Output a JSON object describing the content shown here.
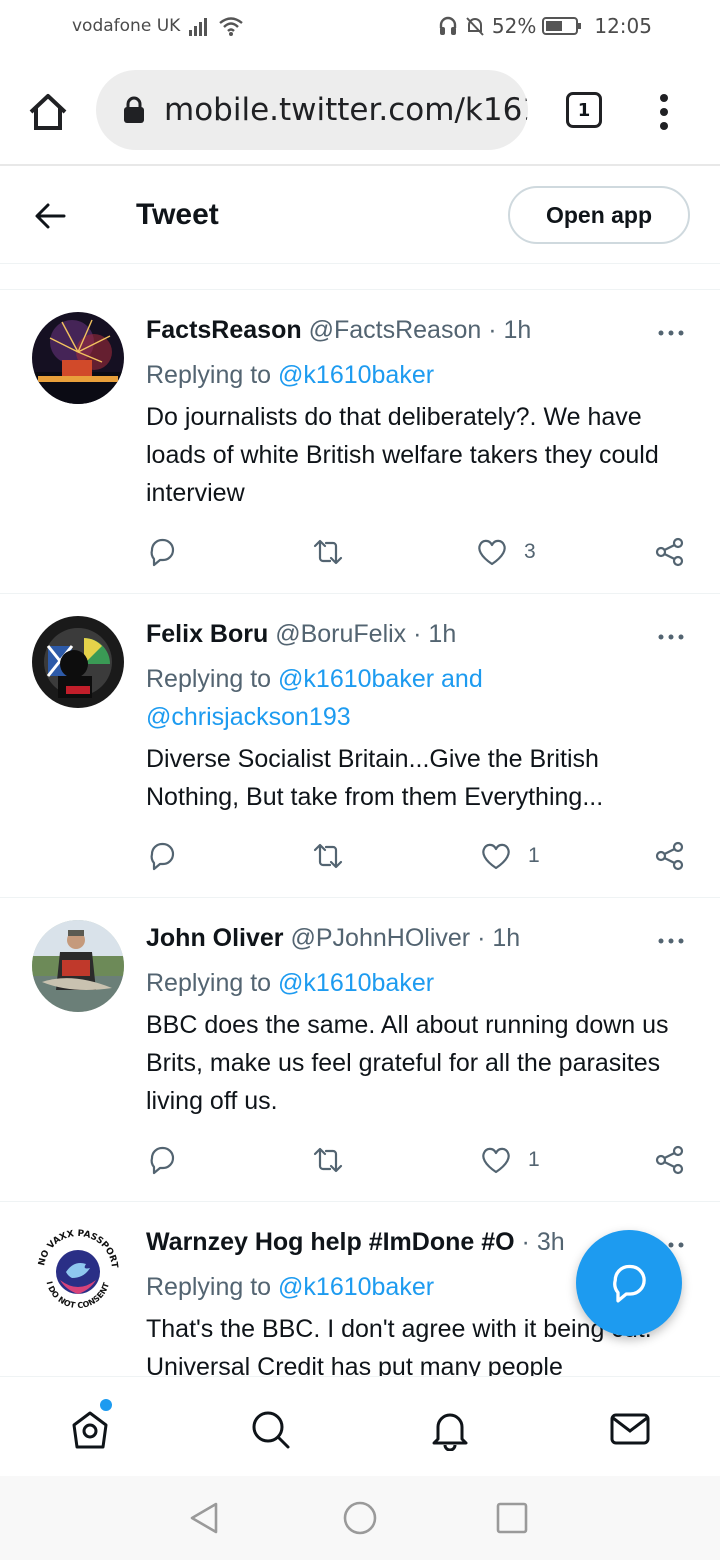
{
  "status_bar": {
    "carrier": "vodafone UK",
    "battery": "52%",
    "time": "12:05"
  },
  "browser": {
    "url": "mobile.twitter.com/k161",
    "tab_count": "1"
  },
  "header": {
    "title": "Tweet",
    "open_app": "Open app"
  },
  "tweets": [
    {
      "name": "FactsReason",
      "handle": "@FactsReason",
      "time": "1h",
      "reply_prefix": "Replying to ",
      "reply_mentions": "@k1610baker",
      "text": "Do journalists do that deliberately?.   We have loads of white British welfare takers they could interview",
      "likes": "3"
    },
    {
      "name": "Felix Boru",
      "handle": "@BoruFelix",
      "time": "1h",
      "reply_prefix": "Replying to ",
      "reply_mentions": "@k1610baker and @chrisjackson193",
      "text": "Diverse Socialist Britain...Give the British Nothing, But take from them Everything...",
      "likes": "1"
    },
    {
      "name": "John Oliver",
      "handle": "@PJohnHOliver",
      "time": "1h",
      "reply_prefix": "Replying to ",
      "reply_mentions": "@k1610baker",
      "text": "BBC does the same. All about running down us Brits, make us feel grateful for all the parasites living off us.",
      "likes": "1"
    },
    {
      "name": "Warnzey Hog help #ImDone #O",
      "handle": "",
      "time": "3h",
      "reply_prefix": "Replying to ",
      "reply_mentions": "@k1610baker",
      "text": "That's the BBC. I don't agree with it being cut. Universal Credit has put many people",
      "avatar_text": "NO VAXX PASSPORTS · I DO NOT CONSENT"
    }
  ],
  "icons": {
    "reply": "reply-icon",
    "retweet": "retweet-icon",
    "like": "heart-icon",
    "share": "share-icon",
    "more": "more-icon"
  },
  "colors": {
    "accent": "#1d9bf0",
    "text": "#0f1419",
    "secondary": "#536471"
  }
}
